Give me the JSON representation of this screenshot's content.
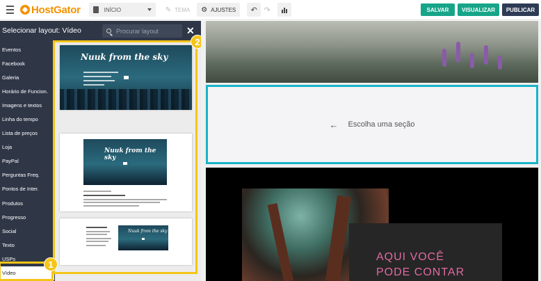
{
  "topbar": {
    "logo": "HostGator",
    "page_select": "INÍCIO",
    "tema_label": "TEMA",
    "ajustes_label": "AJUSTES",
    "salvar_label": "SALVAR",
    "visualizar_label": "VISUALIZAR",
    "publicar_label": "PUBLICAR"
  },
  "sidebar": {
    "title": "Selecionar layout: Vídeo",
    "search_placeholder": "Procurar layout",
    "categories": [
      "Eventos",
      "Facebook",
      "Galeria",
      "Horário de Funcion.",
      "Imagens e textos",
      "Linha do tempo",
      "Lista de preços",
      "Loja",
      "PayPal",
      "Perguntas Freq.",
      "Pontos de Inter.",
      "Produtos",
      "Progresso",
      "Social",
      "Texto",
      "USPs",
      "Vídeo"
    ],
    "active_category": "Vídeo",
    "badge_1": "1",
    "badge_2": "2"
  },
  "thumbnails": {
    "title": "Nuuk from the sky",
    "small_title": "Nuuk from the sky"
  },
  "canvas": {
    "choose_section": "Escolha uma seção",
    "hero_text_line1": "AQUI VOCÊ",
    "hero_text_line2": "PODE CONTAR"
  },
  "colors": {
    "accent_green": "#17a589",
    "publish_navy": "#2d3b55",
    "highlight_yellow": "#f5c518",
    "selection_cyan": "#18b4c9",
    "brand_orange": "#f39200",
    "sidebar_bg": "#2f3747"
  }
}
